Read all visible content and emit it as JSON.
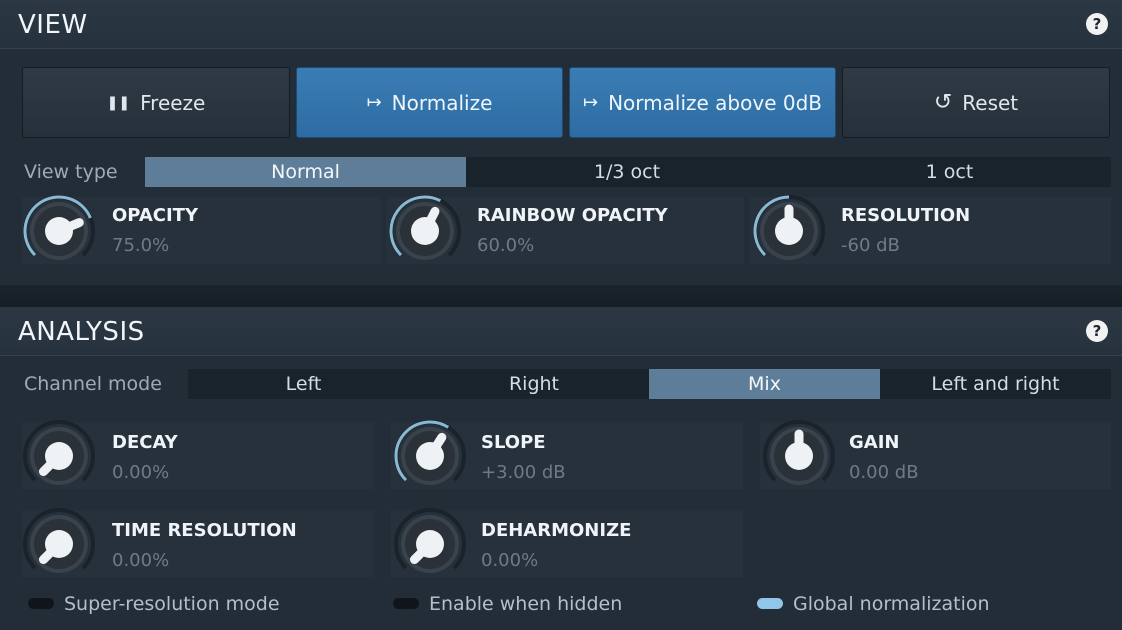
{
  "view": {
    "title": "VIEW",
    "help": "?",
    "buttons": [
      {
        "label": "Freeze",
        "icon": "pause-icon",
        "glyph": "❚❚",
        "active": false
      },
      {
        "label": "Normalize",
        "icon": "arrow-bar-icon",
        "glyph": "↦",
        "active": true
      },
      {
        "label": "Normalize above 0dB",
        "icon": "arrow-bar-icon",
        "glyph": "↦",
        "active": true
      },
      {
        "label": "Reset",
        "icon": "reset-icon",
        "glyph": "↺",
        "active": false
      }
    ],
    "view_type": {
      "label": "View type",
      "options": [
        "Normal",
        "1/3 oct",
        "1 oct"
      ],
      "selected": "Normal"
    },
    "knobs": [
      {
        "title": "OPACITY",
        "value": "75.0%",
        "level": 0.75
      },
      {
        "title": "RAINBOW OPACITY",
        "value": "60.0%",
        "level": 0.6
      },
      {
        "title": "RESOLUTION",
        "value": "-60 dB",
        "level": 0.5
      }
    ]
  },
  "analysis": {
    "title": "ANALYSIS",
    "help": "?",
    "channel_mode": {
      "label": "Channel mode",
      "options": [
        "Left",
        "Right",
        "Mix",
        "Left and right"
      ],
      "selected": "Mix"
    },
    "knobs": [
      {
        "title": "DECAY",
        "value": "0.00%",
        "level": 0.0
      },
      {
        "title": "SLOPE",
        "value": "+3.00 dB",
        "level": 0.62
      },
      {
        "title": "GAIN",
        "value": "0.00 dB",
        "level": 0.5
      },
      {
        "title": "TIME RESOLUTION",
        "value": "0.00%",
        "level": 0.0
      },
      {
        "title": "DEHARMONIZE",
        "value": "0.00%",
        "level": 0.0
      }
    ],
    "toggles": [
      {
        "label": "Super-resolution mode",
        "on": false
      },
      {
        "label": "Enable when hidden",
        "on": false
      },
      {
        "label": "Global normalization",
        "on": true
      }
    ]
  },
  "colors": {
    "accent": "#3a7db4",
    "segment_selected": "#5d7d98",
    "knob_arc": "#9fd3f2",
    "toggle_on": "#8fc6ea"
  }
}
